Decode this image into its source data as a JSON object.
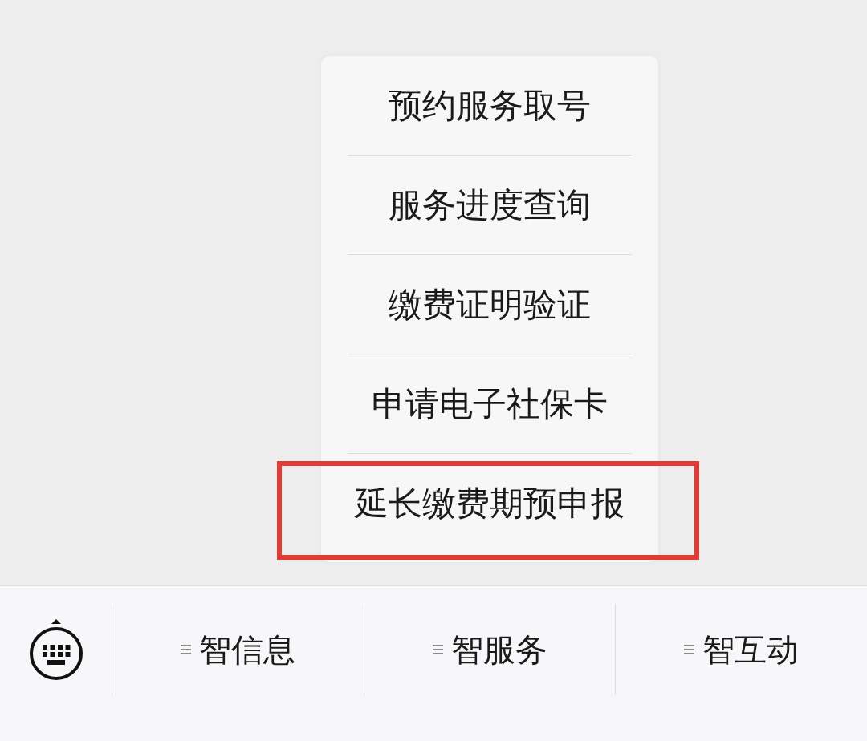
{
  "bottom_bar": {
    "tabs": [
      {
        "label": "智信息"
      },
      {
        "label": "智服务",
        "menu": {
          "items": [
            {
              "label": "预约服务取号",
              "highlighted": false
            },
            {
              "label": "服务进度查询",
              "highlighted": false
            },
            {
              "label": "缴费证明验证",
              "highlighted": false
            },
            {
              "label": "申请电子社保卡",
              "highlighted": false
            },
            {
              "label": "延长缴费期预申报",
              "highlighted": true
            }
          ]
        }
      },
      {
        "label": "智互动"
      }
    ]
  }
}
